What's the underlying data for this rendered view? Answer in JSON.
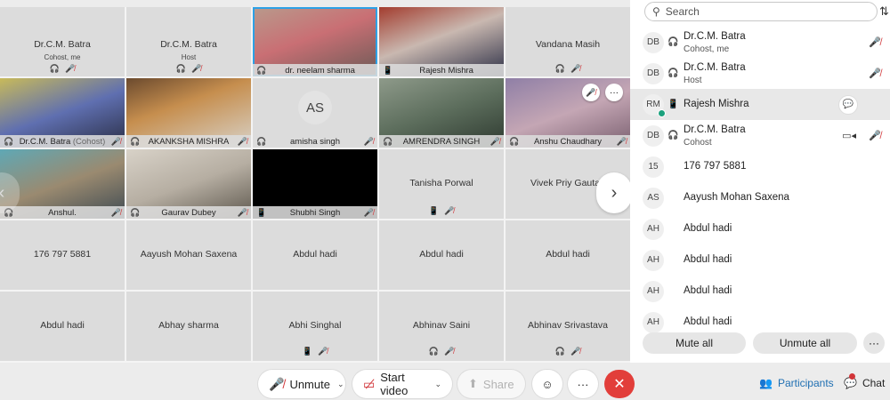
{
  "grid": {
    "r1": {
      "t1": {
        "name": "Dr.C.M. Batra",
        "role": "Cohost, me"
      },
      "t2": {
        "name": "Dr.C.M. Batra",
        "role": "Host"
      },
      "t3": {
        "label": "dr. neelam sharma"
      },
      "t4": {
        "label": "Rajesh Mishra"
      },
      "t5": {
        "name": "Vandana Masih"
      }
    },
    "r2": {
      "t1": {
        "label": "Dr.C.M. Batra",
        "cohost": "(Cohost)"
      },
      "t2": {
        "label": "AKANKSHA MISHRA"
      },
      "t3": {
        "avatar": "AS",
        "label": "amisha singh"
      },
      "t4": {
        "label": "AMRENDRA SINGH"
      },
      "t5": {
        "label": "Anshu Chaudhary"
      }
    },
    "r3": {
      "t1": {
        "label": "Anshul."
      },
      "t2": {
        "label": "Gaurav Dubey"
      },
      "t3": {
        "label": "Shubhi Singh"
      },
      "t4": {
        "name": "Tanisha Porwal"
      },
      "t5": {
        "name": "Vivek Priy Gautam"
      }
    },
    "r4": {
      "t1": {
        "name": "176 797 5881"
      },
      "t2": {
        "name": "Aayush Mohan Saxena"
      },
      "t3": {
        "name": "Abdul hadi"
      },
      "t4": {
        "name": "Abdul hadi"
      },
      "t5": {
        "name": "Abdul hadi"
      }
    },
    "r5": {
      "t1": {
        "name": "Abdul hadi"
      },
      "t2": {
        "name": "Abhay sharma"
      },
      "t3": {
        "name": "Abhi Singhal"
      },
      "t4": {
        "name": "Abhinav Saini"
      },
      "t5": {
        "name": "Abhinav Srivastava"
      }
    }
  },
  "toolbar": {
    "unmute": "Unmute",
    "start_video": "Start video",
    "share": "Share"
  },
  "panel": {
    "search_placeholder": "Search",
    "participants": [
      {
        "initials": "DB",
        "name": "Dr.C.M. Batra",
        "role": "Cohost, me"
      },
      {
        "initials": "DB",
        "name": "Dr.C.M. Batra",
        "role": "Host"
      },
      {
        "initials": "RM",
        "name": "Rajesh Mishra",
        "role": ""
      },
      {
        "initials": "DB",
        "name": "Dr.C.M. Batra",
        "role": "Cohost"
      },
      {
        "initials": "15",
        "name": "176 797 5881",
        "role": ""
      },
      {
        "initials": "AS",
        "name": "Aayush Mohan Saxena",
        "role": ""
      },
      {
        "initials": "AH",
        "name": "Abdul hadi",
        "role": ""
      },
      {
        "initials": "AH",
        "name": "Abdul hadi",
        "role": ""
      },
      {
        "initials": "AH",
        "name": "Abdul hadi",
        "role": ""
      },
      {
        "initials": "AH",
        "name": "Abdul hadi",
        "role": ""
      }
    ],
    "mute_all": "Mute all",
    "unmute_all": "Unmute all"
  },
  "tabs": {
    "participants": "Participants",
    "chat": "Chat"
  },
  "colors": {
    "accent": "#2da1e6",
    "mute_red": "#d13438",
    "end_red": "#e23e3a",
    "active_tab": "#1f6fb2"
  }
}
